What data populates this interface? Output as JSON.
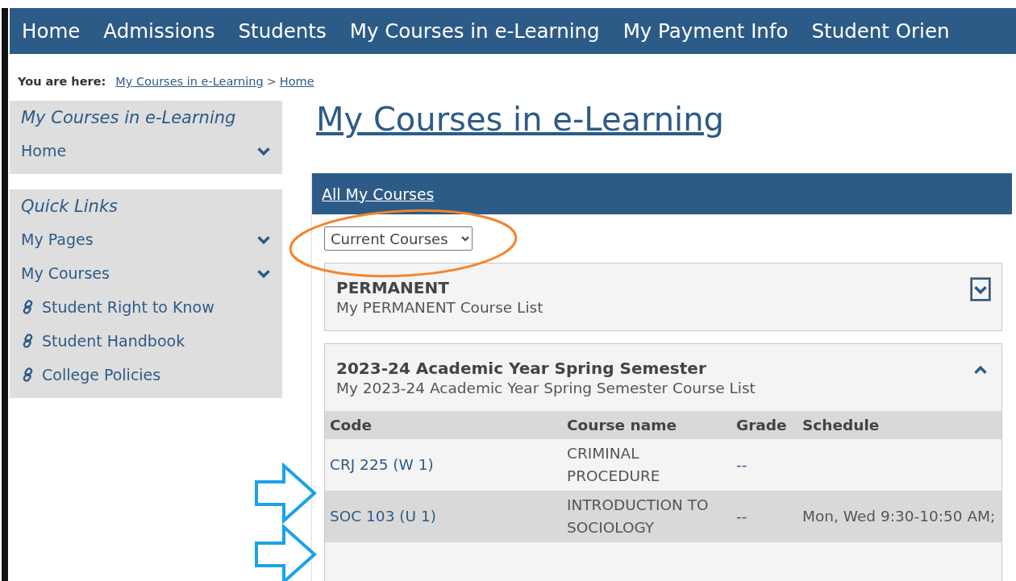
{
  "nav": {
    "items": [
      {
        "label": "Home"
      },
      {
        "label": "Admissions"
      },
      {
        "label": "Students"
      },
      {
        "label": "My Courses in e-Learning"
      },
      {
        "label": "My Payment Info"
      },
      {
        "label": "Student Orien"
      }
    ]
  },
  "breadcrumb": {
    "prefix": "You are here:",
    "links": [
      "My Courses in e-Learning",
      "Home"
    ],
    "separator": ">"
  },
  "sidebar": {
    "sections": [
      {
        "title": "My Courses in e-Learning",
        "items": [
          {
            "label": "Home",
            "kind": "expand"
          }
        ]
      },
      {
        "title": "Quick Links",
        "items": [
          {
            "label": "My Pages",
            "kind": "expand"
          },
          {
            "label": "My Courses",
            "kind": "expand"
          },
          {
            "label": "Student Right to Know",
            "kind": "link"
          },
          {
            "label": "Student Handbook",
            "kind": "link"
          },
          {
            "label": "College Policies",
            "kind": "link"
          }
        ]
      }
    ]
  },
  "page_title": "My Courses in e-Learning",
  "panel": {
    "header_link": "All My Courses",
    "filter": {
      "value": "Current Courses"
    },
    "groups": [
      {
        "title": "PERMANENT",
        "subtitle": "My PERMANENT Course List",
        "expanded": false,
        "focused": true
      },
      {
        "title": "2023-24 Academic Year Spring Semester",
        "subtitle": "My 2023-24 Academic Year Spring Semester Course List",
        "expanded": true,
        "focused": false,
        "table": {
          "columns": [
            "Code",
            "Course name",
            "Grade",
            "Schedule"
          ],
          "rows": [
            {
              "code": "CRJ 225 (W 1)",
              "course_name": "CRIMINAL PROCEDURE",
              "grade": "--"
            },
            {
              "code": "SOC 103 (U 1)",
              "course_name": "INTRODUCTION TO SOCIOLOGY",
              "grade": "--",
              "schedule": "Mon, Wed 9:30-10:50 AM;"
            }
          ]
        }
      }
    ]
  }
}
